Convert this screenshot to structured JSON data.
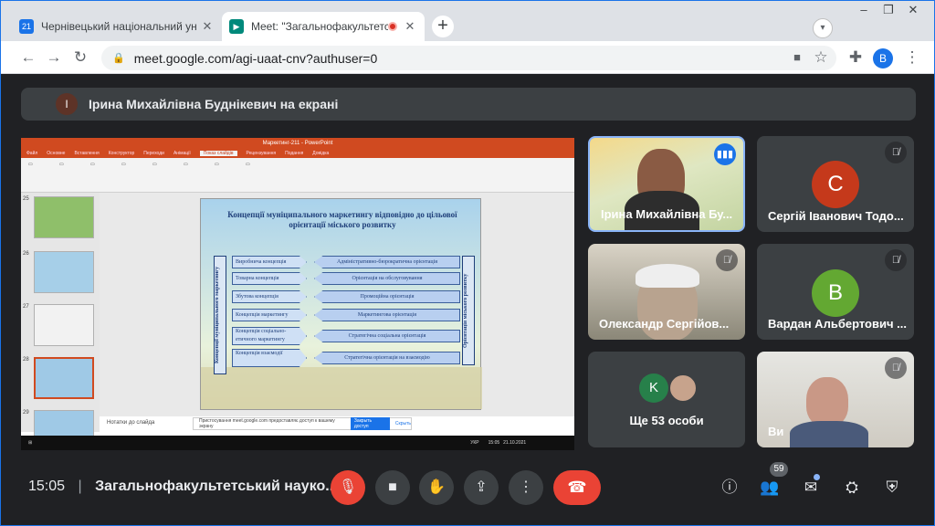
{
  "browser": {
    "tabs": [
      {
        "title": "Чернівецький національний ун",
        "favicon_text": "21",
        "favicon_color": "#1a73e8"
      },
      {
        "title": "Meet: \"Загальнофакультетсь",
        "favicon_text": "▶",
        "favicon_color": "#00897b",
        "recording": true
      }
    ],
    "url": "meet.google.com/agi-uaat-cnv?authuser=0",
    "profile_initial": "B"
  },
  "meet": {
    "presenter_banner": "Ірина Михайлівна Буднікевич на екрані",
    "presenter_initial": "І",
    "participants": [
      {
        "name": "Ірина Михайлівна Бу...",
        "speaking": true
      },
      {
        "name": "Сергій Іванович Тодо...",
        "initial": "С",
        "color": "#c5391b"
      },
      {
        "name": "Олександр Сергійов..."
      },
      {
        "name": "Вардан Альбертович ...",
        "initial": "В",
        "color": "#63a832"
      },
      {
        "name": "Ще 53 особи",
        "initial": "K",
        "color": "#27804a"
      },
      {
        "name": "Ви"
      }
    ],
    "time": "15:05",
    "meeting_title": "Загальнофакультетський науко...",
    "participant_count": "59"
  },
  "shared_screen": {
    "ppt_title": "Маркетинг-211 - PowerPoint",
    "ppt_tabs": [
      "Файл",
      "Основне",
      "Вставлення",
      "Конструктор",
      "Переходи",
      "Анімації",
      "Показ слайдів",
      "Рецензування",
      "Подання",
      "Довідка"
    ],
    "ppt_active_tab": "Показ слайдів",
    "slide_title": "Концепції муніципального маркетингу відповідно до цільової орієнтації міського розвитку",
    "left_vertical": "Концепції муніципального маркетингу",
    "right_vertical": "Орієнтація міського розвитку",
    "rows": [
      {
        "left": "Виробнича концепція",
        "right": "Адміністративно-бюрократична орієнтація"
      },
      {
        "left": "Товарна концепція",
        "right": "Орієнтація на обслуговування"
      },
      {
        "left": "Збутова концепція",
        "right": "Промоційна орієнтація"
      },
      {
        "left": "Концепція маркетингу",
        "right": "Маркетингова орієнтація"
      },
      {
        "left": "Концепція соціально-етичного маркетингу",
        "right": "Стратегічна соціальна орієнтація"
      },
      {
        "left": "Концепція взаємодії",
        "right": "Стратегічна орієнтація на взаємодію"
      }
    ],
    "thumb_numbers": [
      "25",
      "26",
      "27",
      "28",
      "29"
    ],
    "notes": "Нотатки до слайда",
    "share_notice": "Пристосування meet.google.com предоставляє доступ к вашему экрану",
    "stop_share": "Закрыть доступ",
    "hide": "Скрыть",
    "taskbar_lang": "УКР",
    "taskbar_time": "15:05",
    "taskbar_date": "21.10.2021"
  }
}
